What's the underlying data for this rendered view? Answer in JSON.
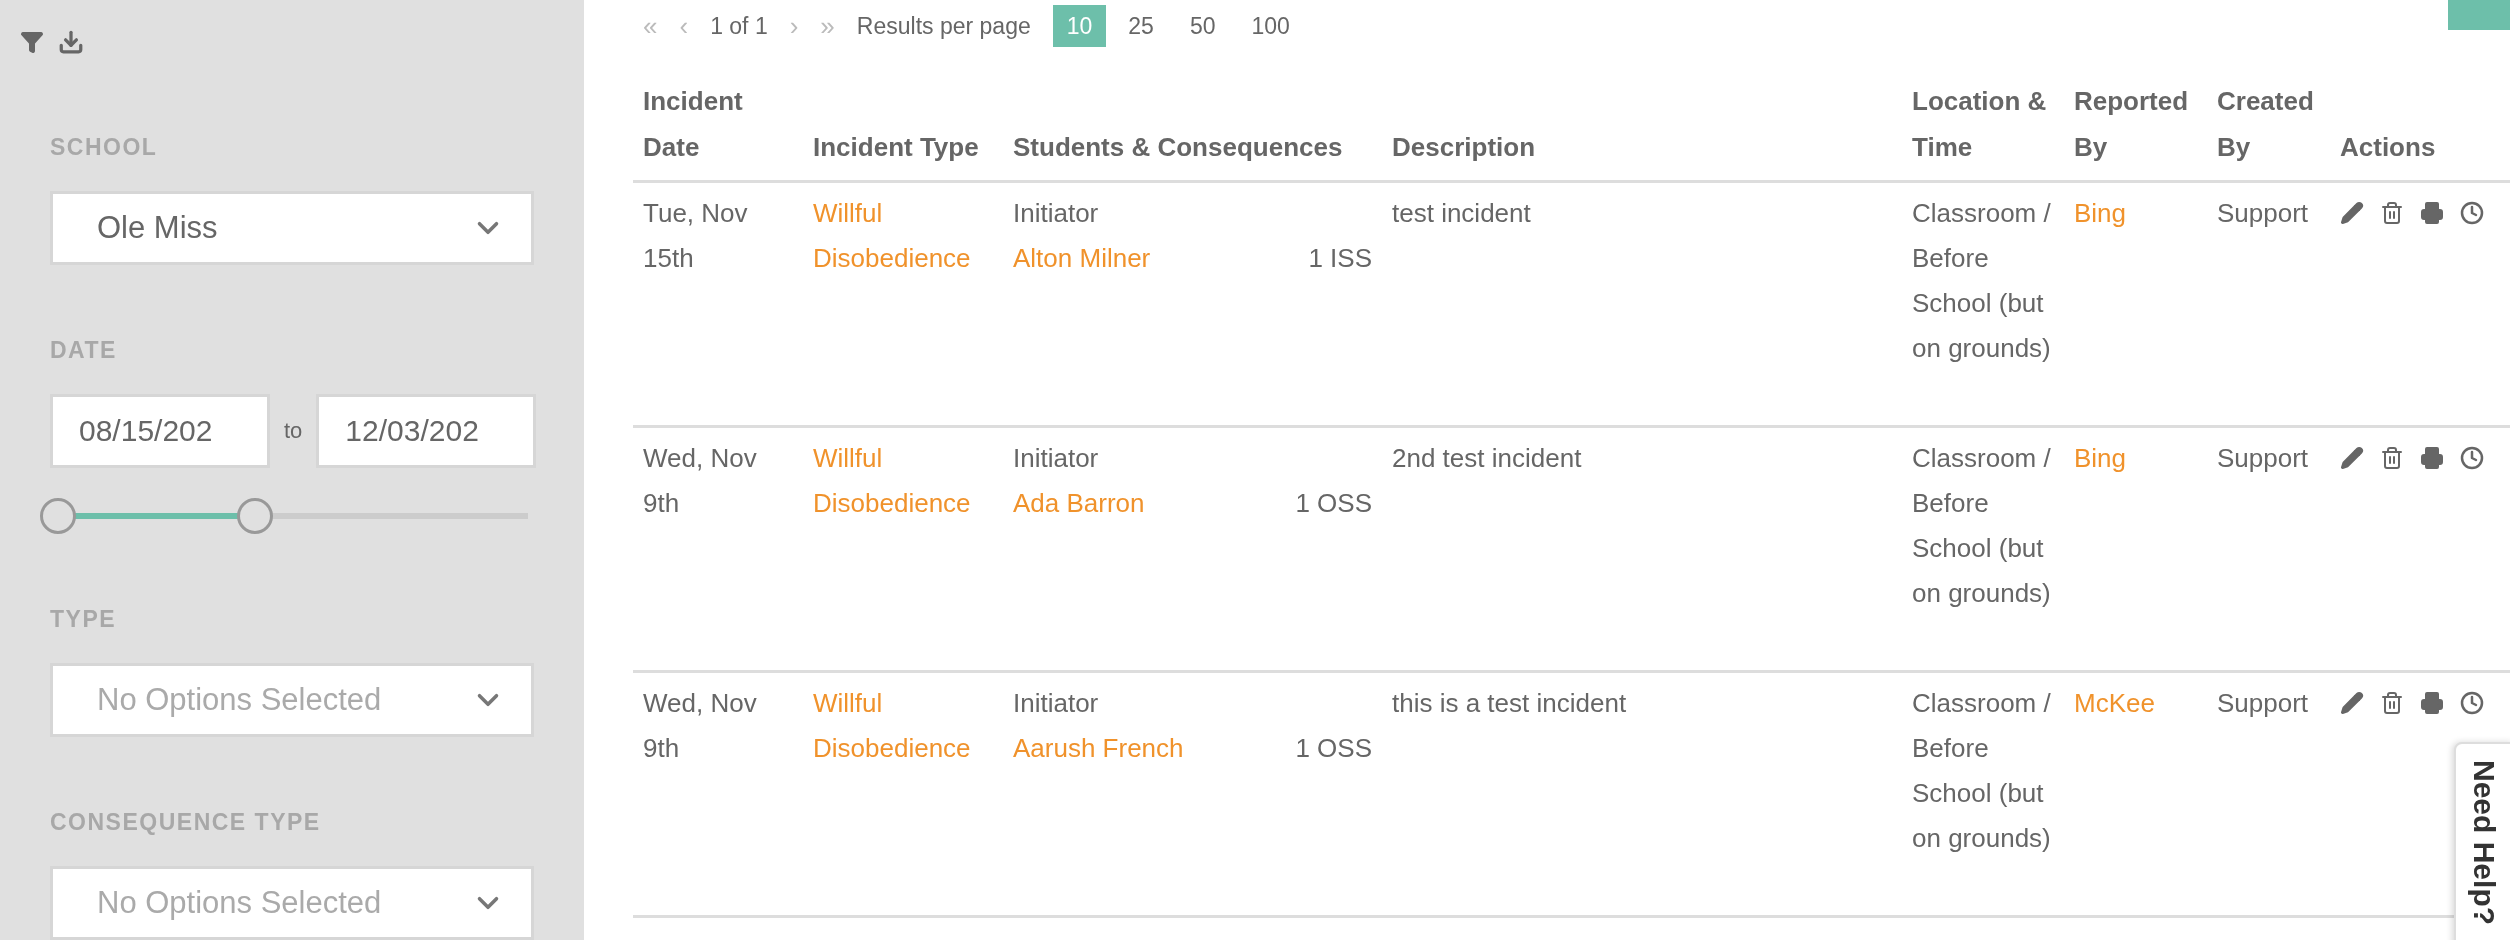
{
  "filters": [
    {
      "kind": "select",
      "label": "SCHOOL",
      "value": "Ole Miss"
    },
    {
      "kind": "date_range",
      "label": "DATE",
      "from": "08/15/202",
      "separator": "to",
      "to": "12/03/202",
      "level": 0.42
    },
    {
      "kind": "select",
      "label": "TYPE",
      "placeholder": "No Options Selected"
    },
    {
      "kind": "select",
      "label": "CONSEQUENCE TYPE",
      "placeholder": "No Options Selected"
    }
  ],
  "pagination": {
    "first": "«",
    "prev": "‹",
    "page": "1 of 1",
    "next": "›",
    "last": "»",
    "results_label": "Results per page",
    "sizes": [
      {
        "label": "10",
        "selected": true
      },
      {
        "label": "25",
        "selected": false
      },
      {
        "label": "50",
        "selected": false
      },
      {
        "label": "100",
        "selected": false
      }
    ]
  },
  "table": {
    "columns": [
      "Incident Date",
      "Incident Type",
      "Students & Consequences",
      "Description",
      "Location & Time",
      "Reported By",
      "Created By",
      "Actions"
    ],
    "rows": [
      {
        "date": "Tue, Nov 15th",
        "type": "Willful Disobedience",
        "role": "Initiator",
        "student": "Alton Milner",
        "consequence": "1 ISS",
        "description": "test incident",
        "location": "Classroom / Before School (but on grounds)",
        "reported_by": "Bing",
        "created_by": "Support"
      },
      {
        "date": "Wed, Nov 9th",
        "type": "Willful Disobedience",
        "role": "Initiator",
        "student": "Ada Barron",
        "consequence": "1 OSS",
        "description": "2nd test incident",
        "location": "Classroom / Before School (but on grounds)",
        "reported_by": "Bing",
        "created_by": "Support"
      },
      {
        "date": "Wed, Nov 9th",
        "type": "Willful Disobedience",
        "role": "Initiator",
        "student": "Aarush French",
        "consequence": "1 OSS",
        "description": "this is a test incident",
        "location": "Classroom / Before School (but on grounds)",
        "reported_by": "McKee",
        "created_by": "Support"
      }
    ]
  },
  "help_tab": {
    "label": "Need Help?"
  }
}
